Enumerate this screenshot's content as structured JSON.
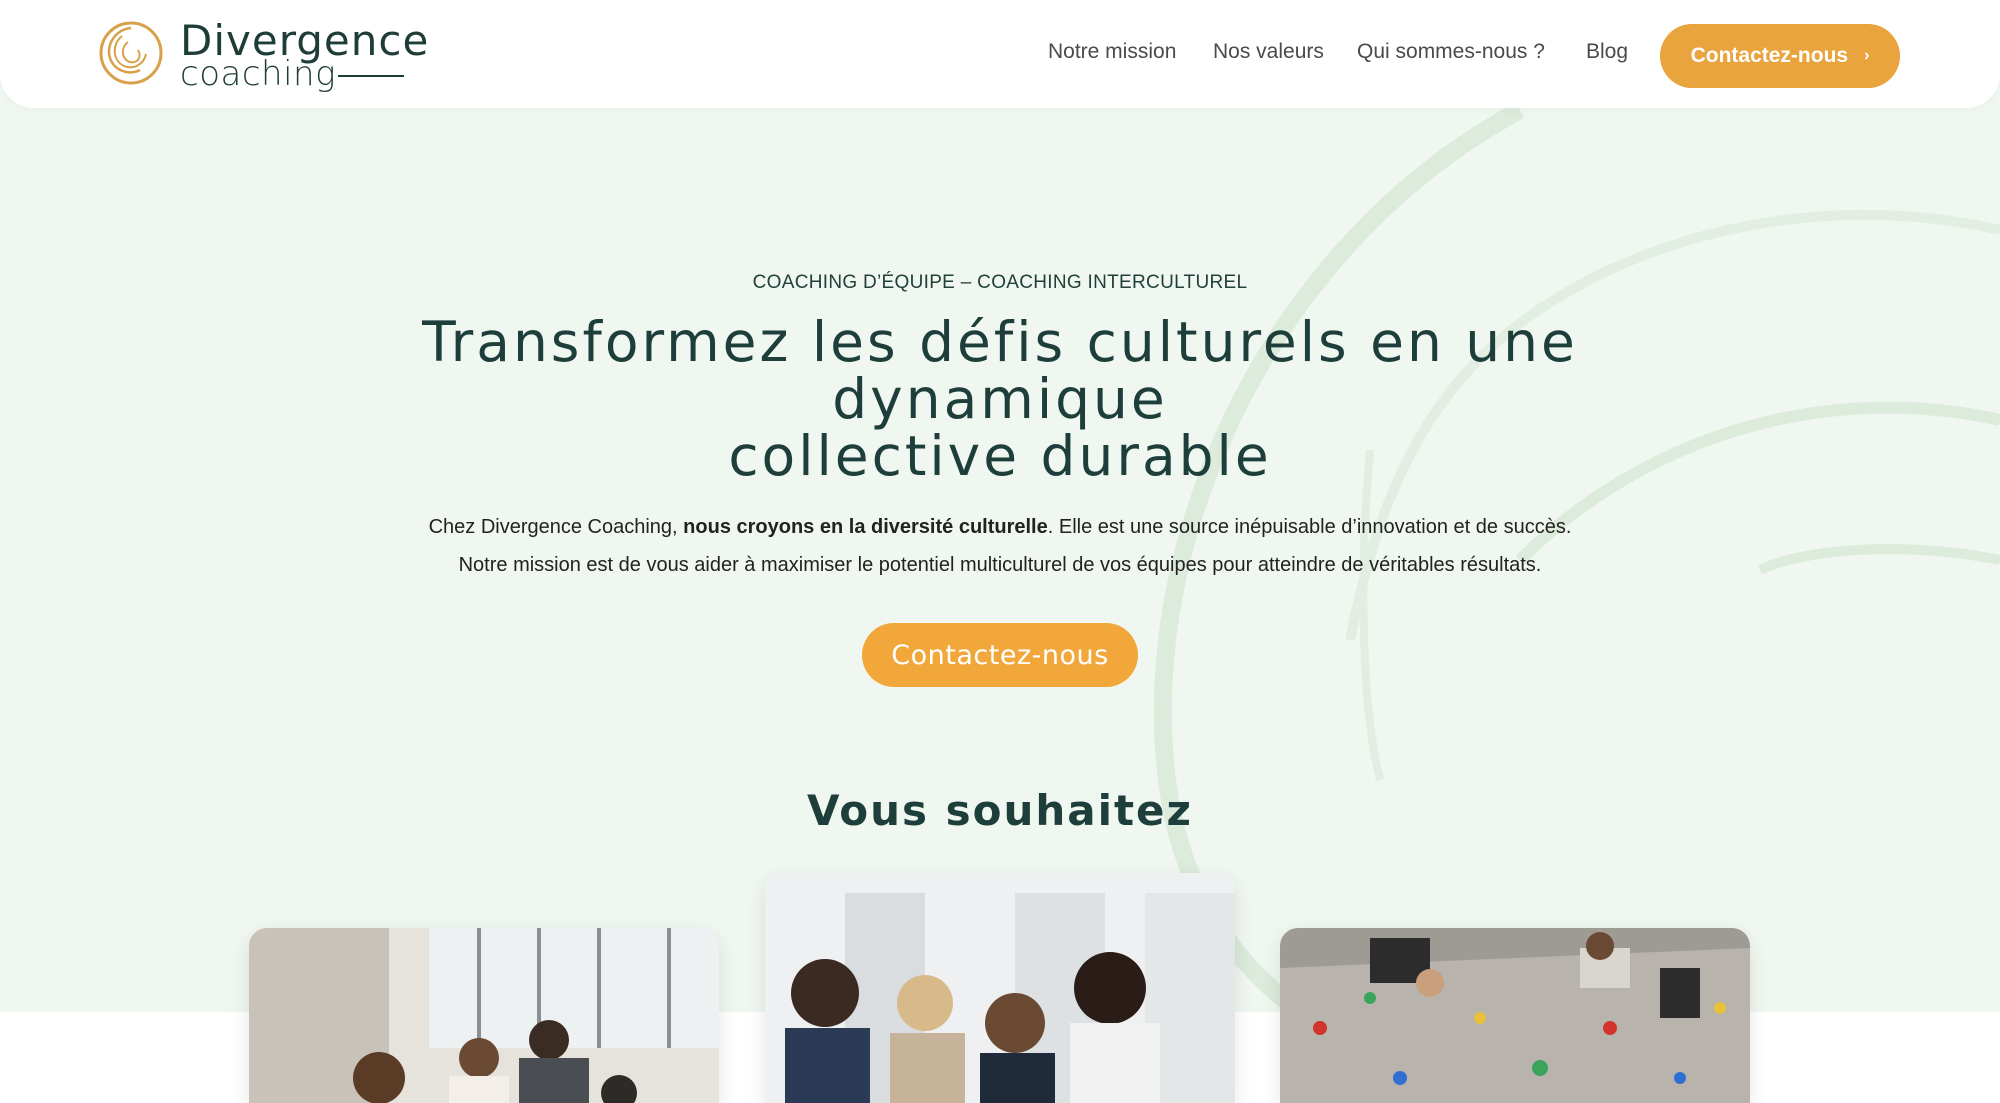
{
  "brand": {
    "name_line1": "Divergence",
    "name_line2": "coaching"
  },
  "nav": {
    "items": [
      {
        "label": "Notre mission"
      },
      {
        "label": "Nos valeurs"
      },
      {
        "label": "Qui sommes-nous ?"
      },
      {
        "label": "Blog"
      }
    ],
    "cta_label": "Contactez-nous",
    "cta_icon": "chevron-right-icon"
  },
  "hero": {
    "eyebrow": "COACHING D’ÉQUIPE – COACHING INTERCULTUREL",
    "title_line1": "Transformez les défis culturels en une dynamique",
    "title_line2": "collective durable",
    "desc_part1": "Chez Divergence Coaching, ",
    "desc_bold": "nous croyons en la diversité culturelle",
    "desc_part2": ". Elle est une source inépuisable d’innovation et de succès.",
    "desc_line2": "Notre mission est de vous aider à maximiser le potentiel multiculturel de vos équipes pour atteindre de véritables résultats.",
    "cta_label": "Contactez-nous"
  },
  "section": {
    "title": "Vous souhaitez"
  },
  "colors": {
    "accent": "#f2a73a",
    "brand_dark": "#1d3e3a",
    "background": "#f0f7f0"
  }
}
